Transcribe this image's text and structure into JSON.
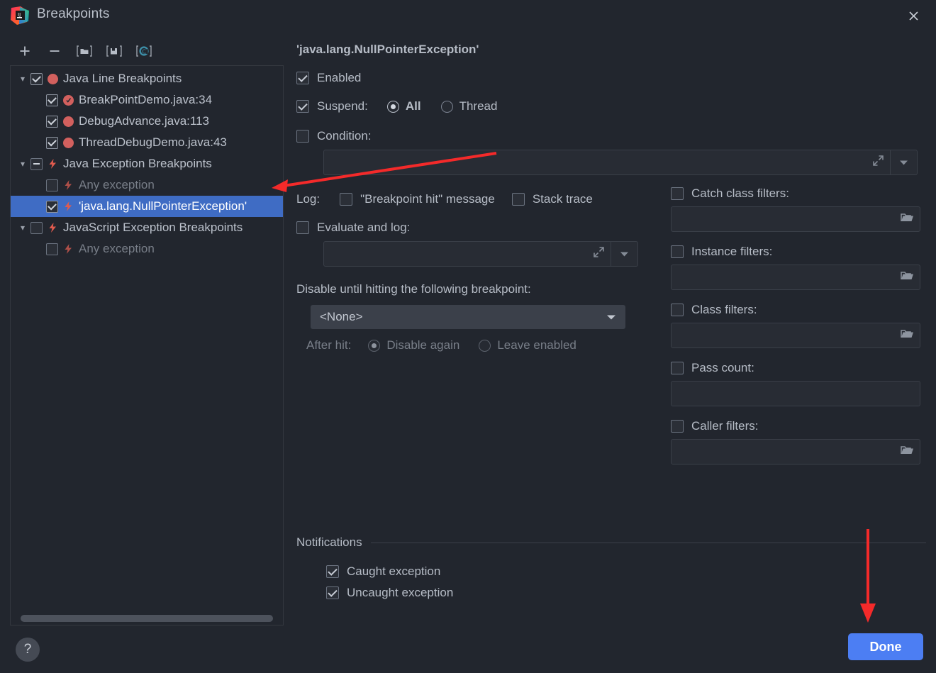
{
  "window": {
    "title": "Breakpoints",
    "logo_icon": "intellij-idea-logo",
    "close_icon": "close-icon"
  },
  "toolbar": {
    "buttons": [
      {
        "name": "add-breakpoint-button",
        "icon": "plus-icon",
        "label": "+"
      },
      {
        "name": "remove-breakpoint-button",
        "icon": "minus-icon",
        "label": "−"
      },
      {
        "name": "group-by-file-button",
        "icon": "folder-bracket-icon",
        "label": ""
      },
      {
        "name": "move-to-group-button",
        "icon": "save-bracket-icon",
        "label": ""
      },
      {
        "name": "group-by-class-button",
        "icon": "class-circle-icon",
        "label": ""
      }
    ]
  },
  "tree": {
    "nodes": [
      {
        "level": 0,
        "twisty": "chevron-down-icon",
        "check": "checked",
        "icon": "red-dot-icon",
        "label": "Java Line Breakpoints",
        "selected": false,
        "dim": false
      },
      {
        "level": 1,
        "twisty": "",
        "check": "checked",
        "icon": "red-dot-check-icon",
        "label": "BreakPointDemo.java:34",
        "selected": false,
        "dim": false
      },
      {
        "level": 1,
        "twisty": "",
        "check": "checked",
        "icon": "red-dot-icon",
        "label": "DebugAdvance.java:113",
        "selected": false,
        "dim": false
      },
      {
        "level": 1,
        "twisty": "",
        "check": "checked",
        "icon": "red-dot-icon",
        "label": "ThreadDebugDemo.java:43",
        "selected": false,
        "dim": false
      },
      {
        "level": 0,
        "twisty": "chevron-down-icon",
        "check": "dash",
        "icon": "red-bolt-icon",
        "label": "Java Exception Breakpoints",
        "selected": false,
        "dim": false
      },
      {
        "level": 1,
        "twisty": "",
        "check": "empty",
        "icon": "red-bolt-icon",
        "label": "Any exception",
        "selected": false,
        "dim": true
      },
      {
        "level": 1,
        "twisty": "",
        "check": "checked",
        "icon": "red-bolt-icon",
        "label": "'java.lang.NullPointerException'",
        "selected": true,
        "dim": false
      },
      {
        "level": 0,
        "twisty": "chevron-down-icon",
        "check": "empty",
        "icon": "red-bolt-icon",
        "label": "JavaScript Exception Breakpoints",
        "selected": false,
        "dim": false
      },
      {
        "level": 1,
        "twisty": "",
        "check": "empty",
        "icon": "red-bolt-icon",
        "label": "Any exception",
        "selected": false,
        "dim": true
      }
    ],
    "scrollbar_name": "tree-horizontal-scrollbar"
  },
  "detail": {
    "title": "'java.lang.NullPointerException'",
    "enabled": {
      "label": "Enabled",
      "checked": true
    },
    "suspend": {
      "label": "Suspend:",
      "checked": true,
      "options": [
        "All",
        "Thread"
      ],
      "selected": "All"
    },
    "condition": {
      "label": "Condition:",
      "checked": false,
      "value": "",
      "expand_icon": "expand-diagonal-icon",
      "dropdown_icon": "chevron-down-icon"
    },
    "log": {
      "label": "Log:",
      "breakpoint_hit": {
        "label": "\"Breakpoint hit\" message",
        "checked": false
      },
      "stack_trace": {
        "label": "Stack trace",
        "checked": false
      }
    },
    "evaluate_and_log": {
      "label": "Evaluate and log:",
      "checked": false,
      "value": "",
      "expand_icon": "expand-diagonal-icon",
      "dropdown_icon": "chevron-down-icon"
    },
    "disable_until": {
      "label": "Disable until hitting the following breakpoint:",
      "selected": "<None>",
      "after_hit_label": "After hit:",
      "after_hit_options": [
        "Disable again",
        "Leave enabled"
      ],
      "after_hit_selected": "Disable again"
    },
    "filters": [
      {
        "name": "catch-class-filters",
        "label": "Catch class filters:",
        "checked": false,
        "value": "",
        "browse_icon": "folder-icon",
        "has_browse": true
      },
      {
        "name": "instance-filters",
        "label": "Instance filters:",
        "checked": false,
        "value": "",
        "browse_icon": "folder-icon",
        "has_browse": true
      },
      {
        "name": "class-filters",
        "label": "Class filters:",
        "checked": false,
        "value": "",
        "browse_icon": "folder-icon",
        "has_browse": true
      },
      {
        "name": "pass-count",
        "label": "Pass count:",
        "checked": false,
        "value": "",
        "browse_icon": "",
        "has_browse": false
      },
      {
        "name": "caller-filters",
        "label": "Caller filters:",
        "checked": false,
        "value": "",
        "browse_icon": "folder-icon",
        "has_browse": true
      }
    ],
    "notifications": {
      "title": "Notifications",
      "caught": {
        "label": "Caught exception",
        "checked": true
      },
      "uncaught": {
        "label": "Uncaught exception",
        "checked": true
      }
    }
  },
  "footer": {
    "help_label": "?",
    "done_label": "Done"
  },
  "annotations": {
    "arrow_color": "#f42a2a",
    "arrow_to_selected_node": "points-left-at-selected-breakpoint",
    "arrow_to_done_button": "points-down-at-done-button"
  },
  "colors": {
    "background": "#22262e",
    "selection": "#3f6cc4",
    "accent_button": "#4c7ef3",
    "breakpoint_red": "#d2605e",
    "annotation_red": "#f42a2a"
  }
}
